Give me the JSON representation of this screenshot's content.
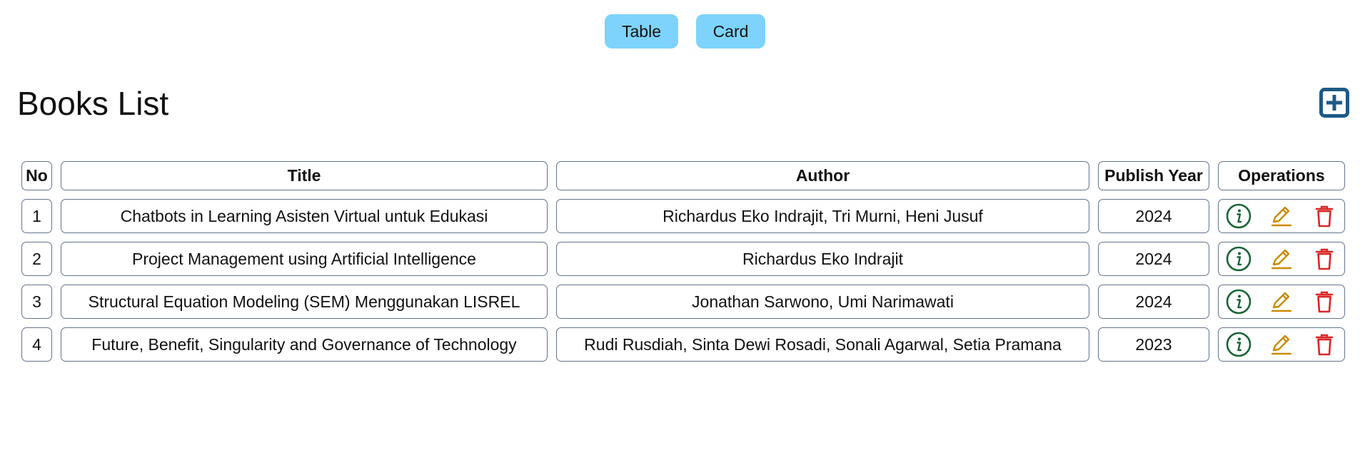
{
  "view_toggle": {
    "table_label": "Table",
    "card_label": "Card"
  },
  "header": {
    "title": "Books List",
    "add_icon": "plus-square-icon"
  },
  "table": {
    "columns": [
      "No",
      "Title",
      "Author",
      "Publish Year",
      "Operations"
    ],
    "rows": [
      {
        "no": "1",
        "title": "Chatbots in Learning Asisten Virtual untuk Edukasi",
        "author": "Richardus Eko Indrajit, Tri Murni, Heni Jusuf",
        "year": "2024"
      },
      {
        "no": "2",
        "title": "Project Management using Artificial Intelligence",
        "author": "Richardus Eko Indrajit",
        "year": "2024"
      },
      {
        "no": "3",
        "title": "Structural Equation Modeling (SEM) Menggunakan LISREL",
        "author": "Jonathan Sarwono, Umi Narimawati",
        "year": "2024"
      },
      {
        "no": "4",
        "title": "Future, Benefit, Singularity and Governance of Technology",
        "author": "Rudi Rusdiah, Sinta Dewi Rosadi, Sonali Agarwal, Setia Pramana",
        "year": "2023"
      }
    ],
    "operation_icons": [
      "info-circle-icon",
      "pencil-icon",
      "trash-icon"
    ]
  },
  "colors": {
    "toggle_bg": "#7dd3fc",
    "add_icon": "#1e5a86",
    "info_icon": "#166534",
    "edit_icon": "#ca8a04",
    "delete_icon": "#dc2626",
    "cell_border": "#64748b"
  }
}
